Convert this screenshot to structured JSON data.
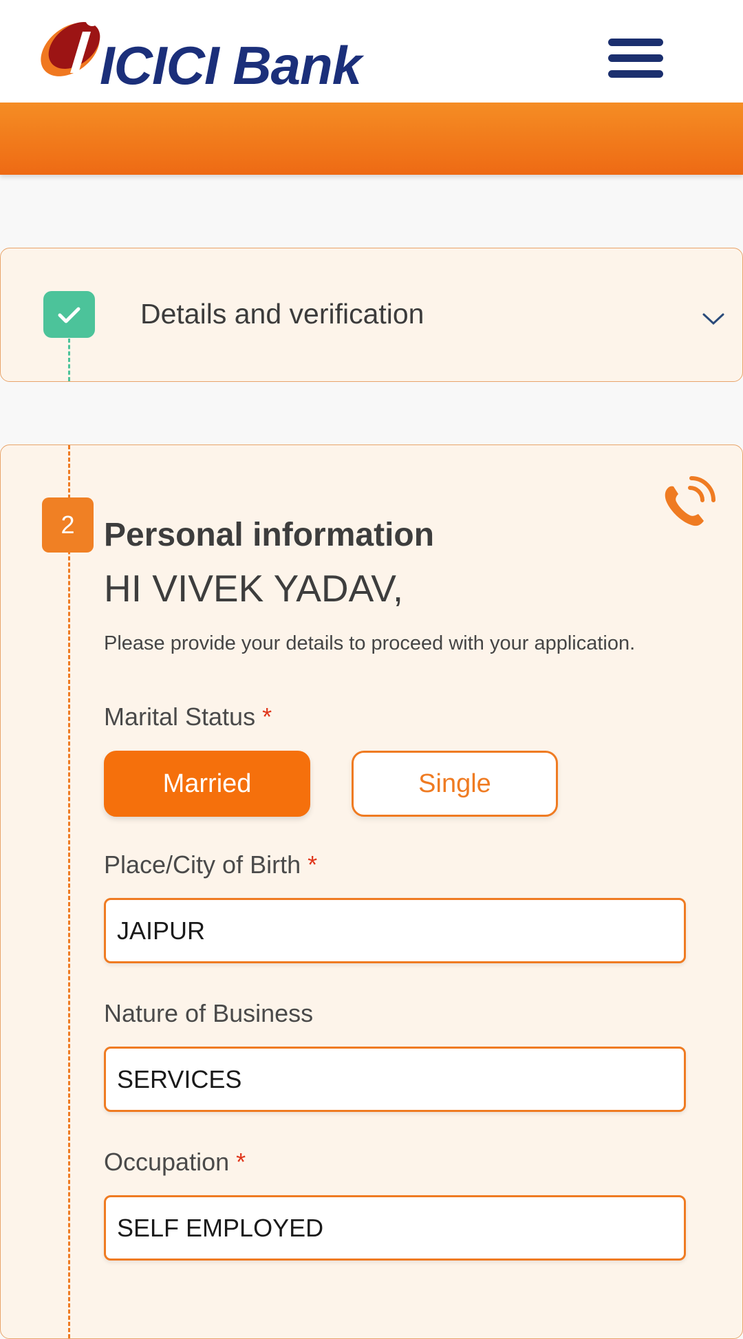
{
  "header": {
    "logo_text": "ICICI Bank",
    "menu_icon": "hamburger-menu-icon"
  },
  "steps": {
    "details": {
      "title": "Details and verification",
      "status": "completed",
      "expand_icon": "chevron-down-icon"
    },
    "personal": {
      "number": "2",
      "title": "Personal information",
      "greeting": "HI VIVEK YADAV,",
      "intro": "Please provide your details to proceed with your application.",
      "call_icon": "phone-call-icon"
    }
  },
  "form": {
    "marital_status": {
      "label": "Marital Status",
      "required_mark": "*",
      "options": [
        "Married",
        "Single"
      ],
      "selected": "Married"
    },
    "birth_place": {
      "label": "Place/City of Birth",
      "required_mark": "*",
      "value": "JAIPUR"
    },
    "business_nature": {
      "label": "Nature of Business",
      "value": "SERVICES"
    },
    "occupation": {
      "label": "Occupation",
      "required_mark": "*",
      "value": "SELF EMPLOYED"
    }
  },
  "colors": {
    "brand_orange": "#ef7b22",
    "brand_blue": "#1b2f7a",
    "success_green": "#4cc39a",
    "required_red": "#e0361b"
  }
}
